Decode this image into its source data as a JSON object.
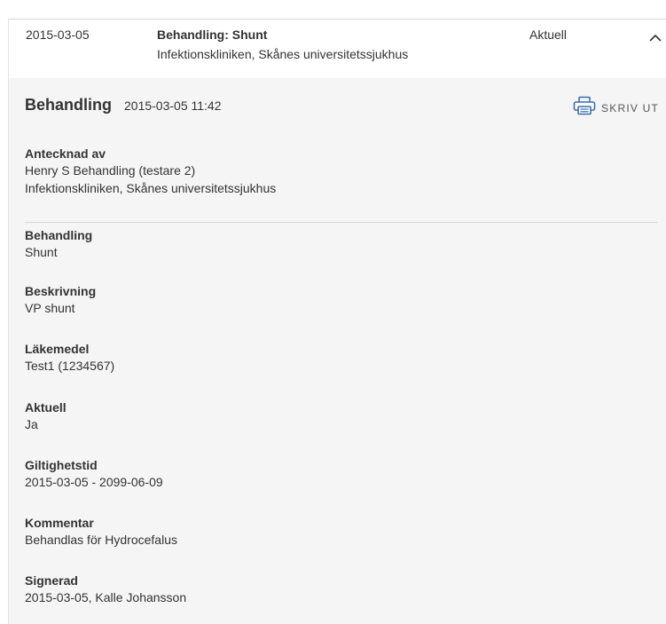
{
  "summary": {
    "date": "2015-03-05",
    "title": "Behandling: Shunt",
    "clinic": "Infektionskliniken, Skånes universitetssjukhus",
    "status": "Aktuell",
    "toggle_icon": "chevron-up-icon"
  },
  "detail": {
    "heading": "Behandling",
    "timestamp": "2015-03-05 11:42",
    "print_label": "SKRIV UT",
    "print_icon": "printer-icon",
    "author": {
      "label": "Antecknad av",
      "name": "Henry S Behandling (testare 2)",
      "clinic": "Infektionskliniken, Skånes universitetssjukhus"
    },
    "fields": [
      {
        "label": "Behandling",
        "value": "Shunt"
      },
      {
        "label": "Beskrivning",
        "value": "VP shunt"
      },
      {
        "label": "Läkemedel",
        "value": "Test1 (1234567)"
      },
      {
        "label": "Aktuell",
        "value": "Ja"
      },
      {
        "label": "Giltighetstid",
        "value": "2015-03-05 - 2099-06-09"
      },
      {
        "label": "Kommentar",
        "value": "Behandlas för Hydrocefalus"
      },
      {
        "label": "Signerad",
        "value": "2015-03-05, Kalle Johansson"
      }
    ]
  }
}
